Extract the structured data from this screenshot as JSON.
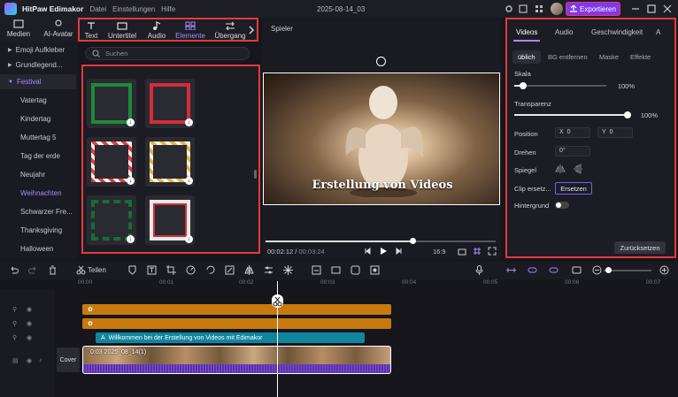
{
  "app": {
    "name": "HitPaw Edimakor",
    "title": "2025-08-14_03",
    "export_label": "Exportieren"
  },
  "menu": [
    "Datei",
    "Einstellungen",
    "Hilfe"
  ],
  "media_tabs": [
    {
      "label": "Medien"
    },
    {
      "label": "AI-Avatar"
    }
  ],
  "top_tabs": [
    {
      "label": "Text"
    },
    {
      "label": "Untertitel"
    },
    {
      "label": "Audio"
    },
    {
      "label": "Elemente"
    },
    {
      "label": "Übergang"
    }
  ],
  "sidebar": {
    "items": [
      {
        "label": "Emoji Aufkleber"
      },
      {
        "label": "Grundlegend..."
      },
      {
        "label": "Festival"
      },
      {
        "label": "Vatertag"
      },
      {
        "label": "Kindertag"
      },
      {
        "label": "Muttertag 5"
      },
      {
        "label": "Tag der erde"
      },
      {
        "label": "Neujahr"
      },
      {
        "label": "Weihnachten"
      },
      {
        "label": "Schwarzer Fre..."
      },
      {
        "label": "Thanksgiving"
      },
      {
        "label": "Halloween"
      }
    ]
  },
  "search": {
    "placeholder": "Suchen"
  },
  "player": {
    "title": "Spieler",
    "caption": "Erstellung von Videos",
    "current_time": "00:02:12",
    "total_time": "00:03:24",
    "aspect": "16:9",
    "progress": 0.64
  },
  "right_panel": {
    "tabs": [
      {
        "label": "Videos"
      },
      {
        "label": "Audio"
      },
      {
        "label": "Geschwindigkeit"
      },
      {
        "label": "A"
      }
    ],
    "subtabs": [
      {
        "label": "üblich"
      },
      {
        "label": "BG entfernen"
      },
      {
        "label": "Maske"
      },
      {
        "label": "Effekte"
      }
    ],
    "scale_label": "Skala",
    "scale_value": "100%",
    "scale_level": 0.1,
    "opacity_label": "Transparenz",
    "opacity_value": "100%",
    "opacity_level": 1.0,
    "position_label": "Position",
    "x_label": "X",
    "x_value": "0",
    "y_label": "Y",
    "y_value": "0",
    "rotate_label": "Drehen",
    "rotate_value": "0°",
    "mirror_label": "Spiegel",
    "clip_label": "Clip ersetz...",
    "clip_button": "Ersetzen",
    "bg_label": "Hintergrund",
    "reset_label": "Zurücksetzen"
  },
  "toolbar": {
    "split_label": "Teilen"
  },
  "ruler": [
    "00:00",
    "00:01",
    "00:02",
    "00:03",
    "00:04",
    "00:05",
    "00:06",
    "00:07"
  ],
  "timeline": {
    "text_clip": "Willkommen bei der Erstellung von Videos mit Edimakor",
    "video_clip": "0:03  2025_08_14(1)",
    "cover_label": "Cover"
  },
  "colors": {
    "accent": "#a78bfa",
    "export": "#7c3aed",
    "highlight_border": "#e23b3b",
    "orange_track": "#c87a0e",
    "teal_track": "#10859e"
  }
}
